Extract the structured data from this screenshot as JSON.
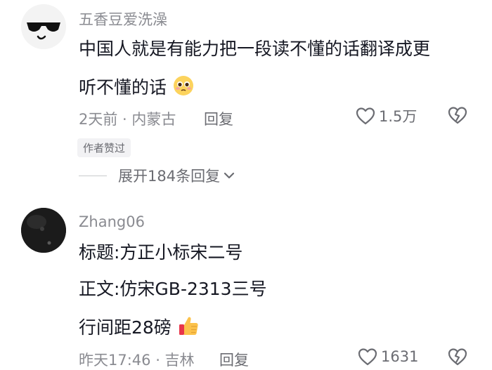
{
  "comments": [
    {
      "username": "五香豆爱洗澡",
      "lines": [
        "中国人就是有能力把一段读不懂的话翻译成更",
        "听不懂的话"
      ],
      "meta": "2天前 · 内蒙古",
      "reply_label": "回复",
      "like_count": "1.5万",
      "badge": "作者赞过",
      "expand_label": "展开184条回复",
      "avatar_icon": "sunglasses-face-icon",
      "inline_emoji": "pleading-face-emoji"
    },
    {
      "username": "Zhang06",
      "lines": [
        "标题:方正小标宋二号",
        "正文:仿宋GB-2313三号",
        "行间距28磅"
      ],
      "meta": "昨天17:46 · 吉林",
      "reply_label": "回复",
      "like_count": "1631",
      "inline_emoji": "thumbs-up-emoji"
    }
  ],
  "colors": {
    "text": "#161823",
    "secondary": "#8a8b91",
    "badge_bg": "#f2f2f4"
  }
}
